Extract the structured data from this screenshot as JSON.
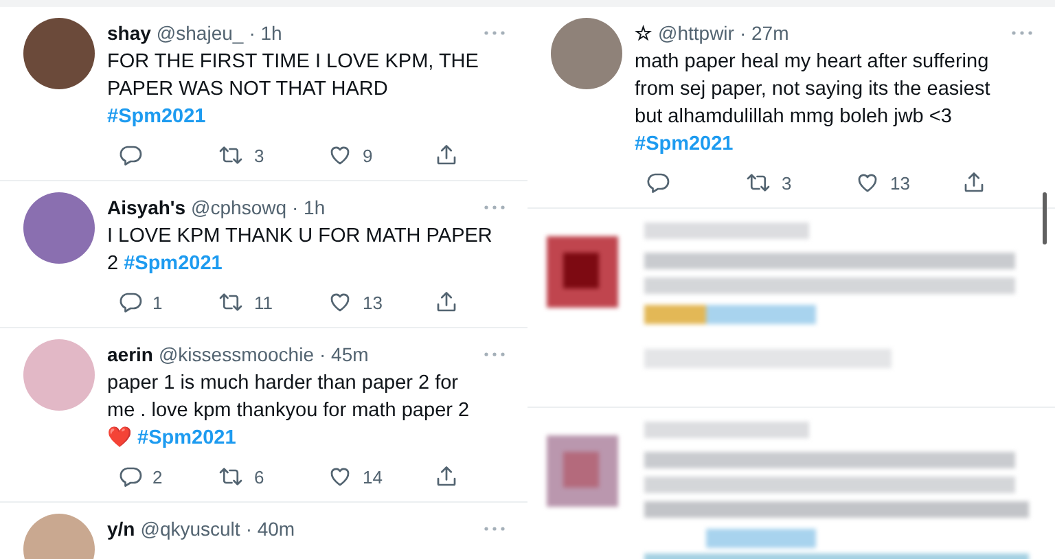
{
  "left_column": {
    "tweets": [
      {
        "name": "shay",
        "handle": "@shajeu_",
        "time": "· 1h",
        "body": "FOR THE FIRST TIME I LOVE KPM, THE\nPAPER WAS NOT THAT HARD\n**#Spm2021**",
        "retweets": "3",
        "likes": "9"
      },
      {
        "name": "Aisyah's",
        "handle": "@cphsowq",
        "time": "· 1h",
        "body": "I LOVE KPM THANK U FOR MATH PAPER\n2 **#Spm2021**",
        "replies": "1",
        "retweets": "11",
        "likes": "13"
      },
      {
        "name": "aerin",
        "handle": "@kissessmoochie",
        "time": "· 45m",
        "body": "paper 1 is much harder than paper 2 for\nme . love kpm thankyou for math paper 2\n❤️ **#Spm2021**",
        "replies": "2",
        "retweets": "6",
        "likes": "14"
      },
      {
        "name": "y/n",
        "handle": "@qkyuscult",
        "time": "· 40m"
      }
    ]
  },
  "right_column": {
    "tweets": [
      {
        "name": "☆",
        "handle": "@httpwir",
        "time": "· 27m",
        "body": "math paper heal my heart after suffering\nfrom sej paper, not saying its the easiest\nbut alhamdulillah mmg boleh jwb <3\n**#Spm2021**",
        "retweets": "3",
        "likes": "13"
      }
    ],
    "hidden_tweets": [
      {
        "kind": "pixelated"
      },
      {
        "kind": "pixelated"
      }
    ]
  }
}
